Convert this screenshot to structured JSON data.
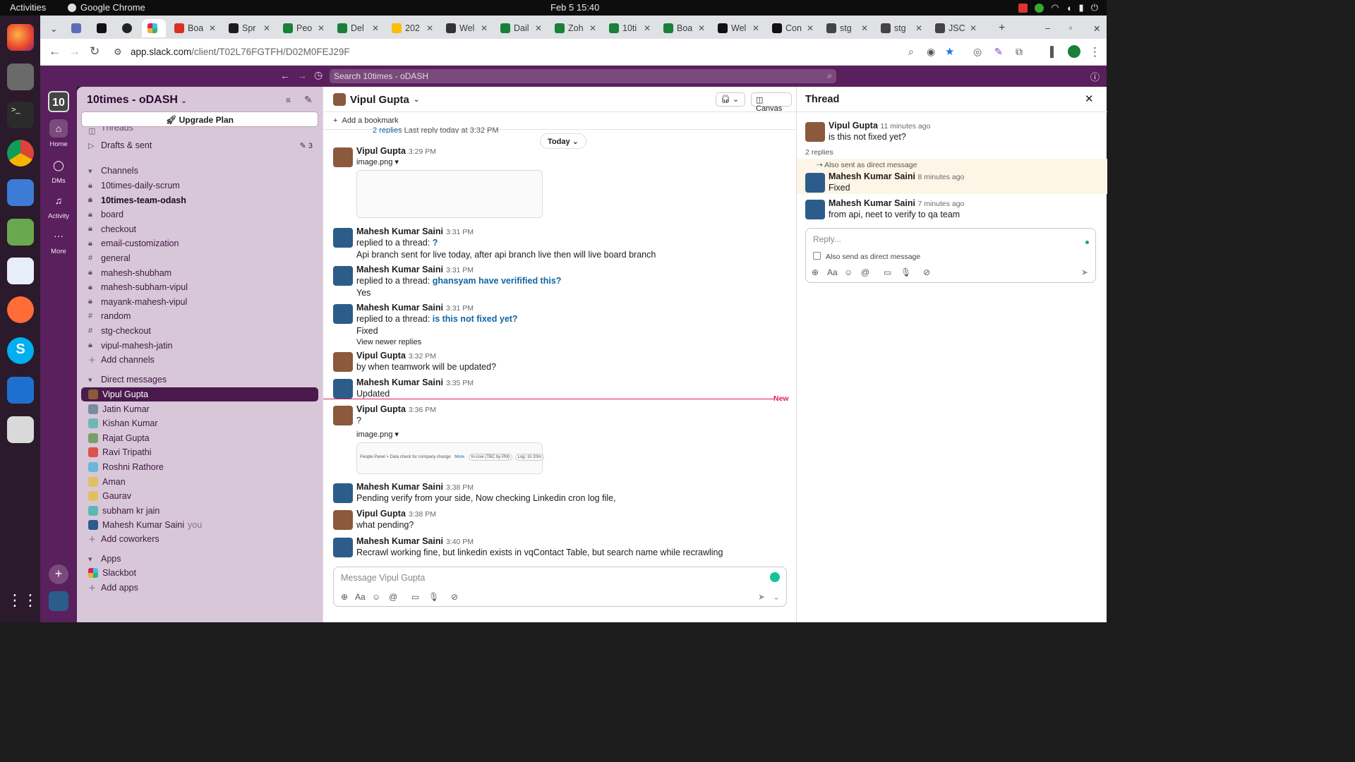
{
  "topbar": {
    "activities": "Activities",
    "app": "Google Chrome",
    "clock": "Feb 5  15:40"
  },
  "tabs": [
    {
      "label": "Boa",
      "color": "#d93025"
    },
    {
      "label": "Spr",
      "color": "#1b1b1b"
    },
    {
      "label": "Peo",
      "color": "#188038"
    },
    {
      "label": "Del",
      "color": "#188038"
    },
    {
      "label": "202",
      "color": "#fbbc04"
    },
    {
      "label": "Wel",
      "color": "#333333"
    },
    {
      "label": "Dail",
      "color": "#188038"
    },
    {
      "label": "Zoh",
      "color": "#188038"
    },
    {
      "label": "10ti",
      "color": "#188038"
    },
    {
      "label": "Boa",
      "color": "#188038"
    },
    {
      "label": "Wel",
      "color": "#111111"
    },
    {
      "label": "Con",
      "color": "#111111"
    },
    {
      "label": "stg",
      "color": "#444444"
    },
    {
      "label": "stg",
      "color": "#444444"
    },
    {
      "label": "JSC",
      "color": "#444444"
    }
  ],
  "url": {
    "host": "app.slack.com",
    "path": "/client/T02L76FGTFH/D02M0FEJ29F"
  },
  "search": {
    "placeholder": "Search 10times - oDASH"
  },
  "rail": {
    "workspace_initials": "10",
    "home": "Home",
    "dms": "DMs",
    "activity": "Activity",
    "more": "More"
  },
  "sidebar": {
    "workspace": "10times - oDASH",
    "upgrade": "Upgrade Plan",
    "threads": "Threads",
    "drafts": "Drafts & sent",
    "drafts_count": "3",
    "channels_header": "Channels",
    "channels": [
      {
        "icon": "lock",
        "name": "10times-daily-scrum",
        "bold": false
      },
      {
        "icon": "lock",
        "name": "10times-team-odash",
        "bold": true
      },
      {
        "icon": "lock",
        "name": "board",
        "bold": false
      },
      {
        "icon": "lock",
        "name": "checkout",
        "bold": false
      },
      {
        "icon": "lock",
        "name": "email-customization",
        "bold": false
      },
      {
        "icon": "hash",
        "name": "general",
        "bold": false
      },
      {
        "icon": "lock",
        "name": "mahesh-shubham",
        "bold": false
      },
      {
        "icon": "lock",
        "name": "mahesh-subham-vipul",
        "bold": false
      },
      {
        "icon": "lock",
        "name": "mayank-mahesh-vipul",
        "bold": false
      },
      {
        "icon": "hash",
        "name": "random",
        "bold": false
      },
      {
        "icon": "hash",
        "name": "stg-checkout",
        "bold": false
      },
      {
        "icon": "lock",
        "name": "vipul-mahesh-jatin",
        "bold": false
      }
    ],
    "add_channels": "Add channels",
    "dm_header": "Direct messages",
    "dms": [
      {
        "name": "Vipul Gupta",
        "color": "#8b5a3c",
        "selected": true
      },
      {
        "name": "Jatin Kumar",
        "color": "#7a8aa0"
      },
      {
        "name": "Kishan Kumar",
        "color": "#6fb7b5"
      },
      {
        "name": "Rajat Gupta",
        "color": "#7aa06a"
      },
      {
        "name": "Ravi Tripathi",
        "color": "#d9534f"
      },
      {
        "name": "Roshni Rathore",
        "color": "#6cb6d8"
      },
      {
        "name": "Aman",
        "color": "#e0c060"
      },
      {
        "name": "Gaurav",
        "color": "#e0c060"
      },
      {
        "name": "subham kr jain",
        "color": "#5cb8b2"
      },
      {
        "name": "Mahesh Kumar Saini",
        "color": "#2c5d8a",
        "suffix": "you"
      }
    ],
    "add_coworkers": "Add coworkers",
    "apps_header": "Apps",
    "slackbot": "Slackbot",
    "add_apps": "Add apps"
  },
  "channel": {
    "title": "Vipul Gupta",
    "canvas": "Canvas",
    "bookmark": "Add a bookmark",
    "replies_note": "2 replies",
    "last_reply": "Last reply today at 3:32 PM",
    "today": "Today",
    "new_label": "New",
    "composer_placeholder": "Message Vipul Gupta"
  },
  "messages": [
    {
      "name": "Vipul Gupta",
      "time": "3:29 PM",
      "file": "image.png"
    },
    {
      "name": "Mahesh Kumar Saini",
      "time": "3:31 PM",
      "prefix": "replied to a thread: ",
      "thread_link": "?",
      "text": "Api branch sent for live today, after api branch live then will live board branch"
    },
    {
      "name": "Mahesh Kumar Saini",
      "time": "3:31 PM",
      "prefix": "replied to a thread: ",
      "thread_link": "ghansyam have verifified this?",
      "text": "Yes"
    },
    {
      "name": "Mahesh Kumar Saini",
      "time": "3:31 PM",
      "prefix": "replied to a thread: ",
      "thread_link": "is this not fixed yet?",
      "text": "Fixed",
      "extra": "View newer replies"
    },
    {
      "name": "Vipul Gupta",
      "time": "3:32 PM",
      "text": "by when teamwork will be updated?"
    },
    {
      "name": "Mahesh Kumar Saini",
      "time": "3:35 PM",
      "text": "Updated"
    },
    {
      "name": "Vipul Gupta",
      "time": "3:36 PM",
      "text": "?",
      "file": "image.png",
      "img_text": "People Panel > Data check for company change",
      "img_more": "More",
      "img_badge": "In-Live (TBC by PM)",
      "img_log": "Log: 1h 20m"
    },
    {
      "name": "Mahesh Kumar Saini",
      "time": "3:38 PM",
      "text": "Pending verify from your side, Now checking Linkedin cron log file,"
    },
    {
      "name": "Vipul Gupta",
      "time": "3:38 PM",
      "text": "what pending?"
    },
    {
      "name": "Mahesh Kumar Saini",
      "time": "3:40 PM",
      "text": "Recrawl working fine, but linkedin exists in vqContact Table, but search name while recrawling"
    }
  ],
  "thread": {
    "title": "Thread",
    "root": {
      "name": "Vipul Gupta",
      "time": "11 minutes ago",
      "text": "is this not fixed yet?"
    },
    "replies_count": "2 replies",
    "also_sent": "Also sent as direct message",
    "replies": [
      {
        "name": "Mahesh Kumar Saini",
        "time": "8 minutes ago",
        "text": "Fixed"
      },
      {
        "name": "Mahesh Kumar Saini",
        "time": "7 minutes ago",
        "text": "from api, neet to verify to qa team"
      }
    ],
    "reply_placeholder": "Reply...",
    "also_send_label": "Also send as direct message"
  }
}
